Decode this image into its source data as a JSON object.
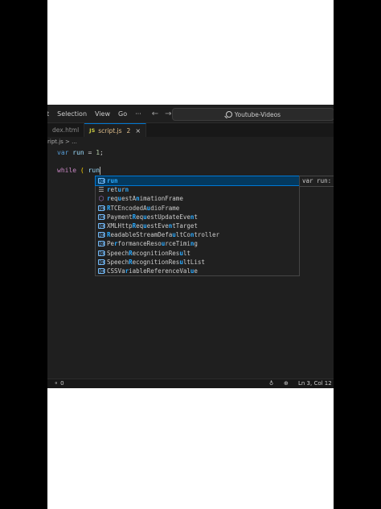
{
  "menu": {
    "items": [
      "t",
      "Selection",
      "View",
      "Go",
      "···"
    ],
    "back_arrow": "←",
    "forward_arrow": "→"
  },
  "command_center": {
    "label": "Youtube-Videos"
  },
  "tabs": [
    {
      "label": "dex.html"
    },
    {
      "badge": "JS",
      "label": "script.js",
      "problems": "2",
      "close": "×"
    }
  ],
  "breadcrumb": "ript.js > ...",
  "code": {
    "line1": {
      "kw": "var",
      "name": "run",
      "op": " = ",
      "num": "1",
      "end": ";"
    },
    "line3": {
      "kw": "while",
      "open": "(",
      "typed": "run"
    }
  },
  "suggestions": [
    {
      "icon": "variable-icon",
      "match": "run",
      "rest": ""
    },
    {
      "icon": "keyword-icon",
      "match": "r",
      "rest": "et",
      "match2": "u",
      "rest2": "r",
      "match3": "n",
      "rest3": ""
    },
    {
      "icon": "method-icon",
      "pre": "",
      "match": "r",
      "rest": "eq",
      "match2": "u",
      "rest2": "estA",
      "match3": "n",
      "rest3": "imationFrame"
    },
    {
      "icon": "variable-icon",
      "match": "R",
      "rest": "TCEncodedA",
      "match2": "u",
      "rest2": "dioFrame",
      "match3": "",
      "rest3": ""
    },
    {
      "icon": "variable-icon",
      "match": "",
      "rest": "PaymentRequestUpdateEvent"
    },
    {
      "icon": "variable-icon",
      "match": "",
      "rest": "XMLHttpRequestEventTarget"
    },
    {
      "icon": "variable-icon",
      "match": "",
      "rest": "ReadableStreamDefaultController"
    },
    {
      "icon": "variable-icon",
      "match": "",
      "rest": "PerformanceResourceTiming"
    },
    {
      "icon": "variable-icon",
      "match": "",
      "rest": "SpeechRecognitionResult"
    },
    {
      "icon": "variable-icon",
      "match": "",
      "rest": "SpeechRecognitionResultList"
    },
    {
      "icon": "variable-icon",
      "match": "",
      "rest": "CSSVariableReferenceValue"
    }
  ],
  "suggestion_labels": [
    "run",
    "return",
    "requestAnimationFrame",
    "RTCEncodedAudioFrame",
    "PaymentRequestUpdateEvent",
    "XMLHttpRequestEventTarget",
    "ReadableStreamDefaultController",
    "PerformanceResourceTiming",
    "SpeechRecognitionResult",
    "SpeechRecognitionResultList",
    "CSSVariableReferenceValue"
  ],
  "detail": "var run:",
  "status": {
    "ports": "0",
    "position": "Ln 3, Col 12"
  },
  "colors": {
    "editor_bg": "#1f1f1f",
    "keyword": "#569cd6",
    "control_keyword": "#c586c0",
    "variable": "#9cdcfe",
    "number": "#b5cea8",
    "match_highlight": "#2aaaff",
    "selection": "#04395e"
  }
}
